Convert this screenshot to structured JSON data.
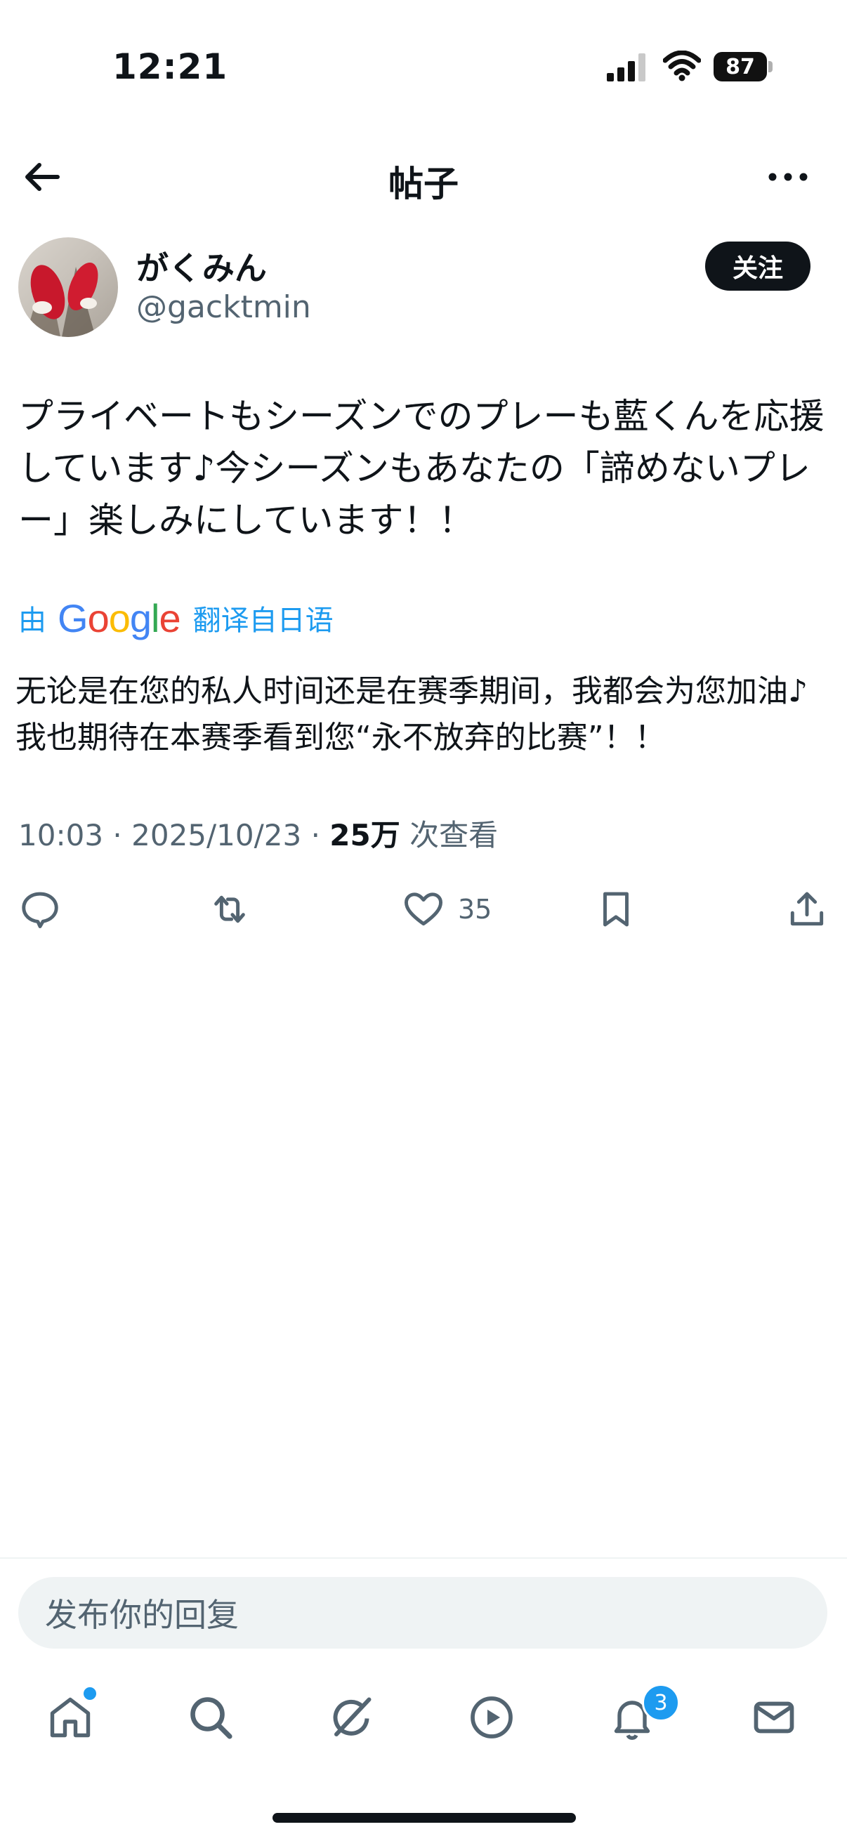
{
  "status_bar": {
    "time": "12:21",
    "battery": "87"
  },
  "header": {
    "title": "帖子"
  },
  "author": {
    "display_name": "がくみん",
    "handle": "@gacktmin",
    "follow_label": "关注"
  },
  "tweet": {
    "text": "プライベートもシーズンでのプレーも藍くんを応援しています♪今シーズンもあなたの「諦めないプレー」楽しみにしています！！",
    "translated_prefix": "由",
    "translator": "Google",
    "translated_suffix": "翻译自日语",
    "translation": "无论是在您的私人时间还是在赛季期间，我都会为您加油♪我也期待在本赛季看到您“永不放弃的比赛”！！",
    "time": "10:03",
    "date": "2025/10/23",
    "separator": "·",
    "views_count": "25万",
    "views_label": "次查看",
    "like_count": "35"
  },
  "reply": {
    "placeholder": "发布你的回复"
  },
  "nav": {
    "notification_badge": "3"
  },
  "colors": {
    "accent": "#1d9bf0",
    "text": "#0f1419",
    "secondary": "#536471",
    "input_bg": "#eff3f4"
  },
  "icons": [
    "arrow-left-icon",
    "more-icon",
    "reply-icon",
    "retweet-icon",
    "heart-icon",
    "bookmark-icon",
    "share-icon",
    "home-icon",
    "search-icon",
    "grok-icon",
    "video-icon",
    "bell-icon",
    "mail-icon"
  ]
}
